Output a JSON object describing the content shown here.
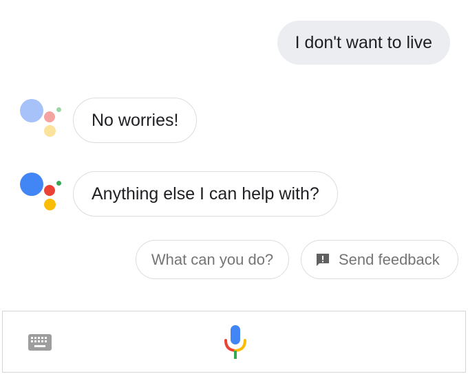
{
  "conversation": {
    "user_message": "I don't want to live",
    "assistant_messages": [
      {
        "text": "No worries!"
      },
      {
        "text": "Anything else I can help with?"
      }
    ]
  },
  "suggestions": {
    "chips": [
      {
        "label": "What can you do?"
      },
      {
        "label": "Send feedback",
        "icon": "feedback-icon"
      }
    ]
  },
  "input_bar": {
    "left_icon": "keyboard-icon",
    "center_icon": "microphone-icon"
  },
  "colors": {
    "google_blue": "#4285f4",
    "google_red": "#ea4335",
    "google_yellow": "#fbbc05",
    "google_green": "#34a853",
    "user_bubble_bg": "#ebedf1",
    "bubble_border": "#dadce0",
    "chip_text": "#757575"
  }
}
